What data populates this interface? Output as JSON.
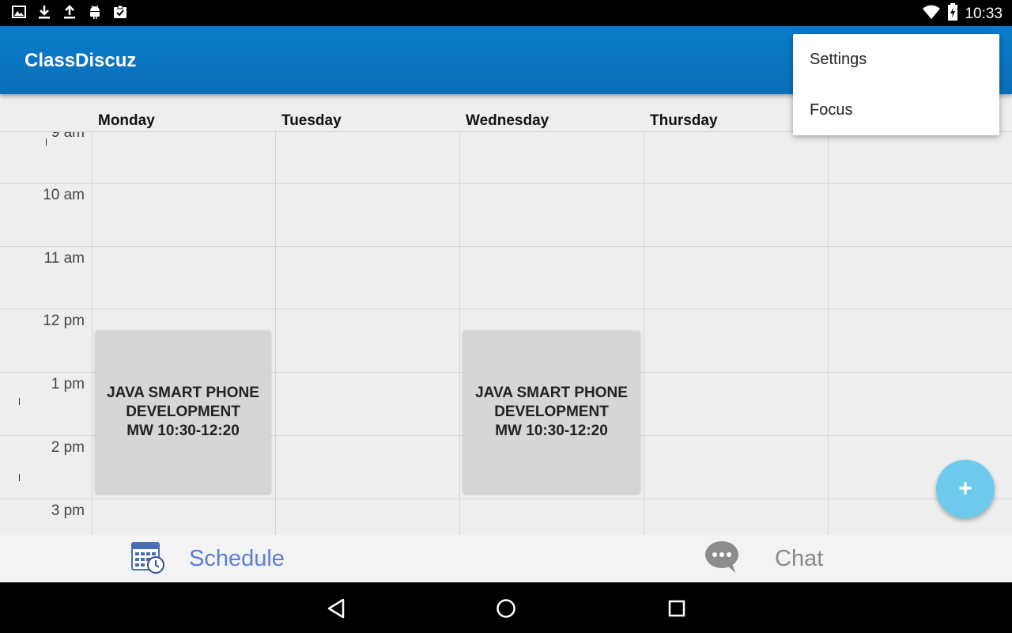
{
  "status_bar": {
    "time": "10:33",
    "left_icons": [
      "image-icon",
      "download-icon",
      "upload-icon",
      "android-icon",
      "clipboard-check-icon"
    ],
    "right_icons": [
      "wifi-icon",
      "battery-charging-icon"
    ]
  },
  "app_bar": {
    "title": "ClassDiscuz"
  },
  "menu": {
    "items": [
      {
        "label": "Settings"
      },
      {
        "label": "Focus"
      }
    ]
  },
  "calendar": {
    "days": [
      "Monday",
      "Tuesday",
      "Wednesday",
      "Thursday"
    ],
    "hours": [
      "9 am",
      "10 am",
      "11 am",
      "12 pm",
      "1 pm",
      "2 pm",
      "3 pm"
    ],
    "events": [
      {
        "day": "Monday",
        "line1": "JAVA SMART PHONE",
        "line2": "DEVELOPMENT",
        "line3": "MW 10:30-12:20"
      },
      {
        "day": "Wednesday",
        "line1": "JAVA SMART PHONE",
        "line2": "DEVELOPMENT",
        "line3": "MW 10:30-12:20"
      }
    ]
  },
  "fab": {
    "label": "+"
  },
  "bottom_tabs": {
    "schedule": {
      "label": "Schedule",
      "icon": "calendar-clock-icon",
      "color": "#5b7fd6"
    },
    "chat": {
      "label": "Chat",
      "icon": "chat-bubble-icon",
      "color": "#8a8a8a"
    }
  },
  "nav_bar": {
    "buttons": [
      "back-icon",
      "home-icon",
      "recents-icon"
    ]
  },
  "colors": {
    "app_bar": "#0a7ccc",
    "fab": "#6fcbee",
    "event": "#d6d6d6",
    "grid_bg": "#eeeeee"
  }
}
